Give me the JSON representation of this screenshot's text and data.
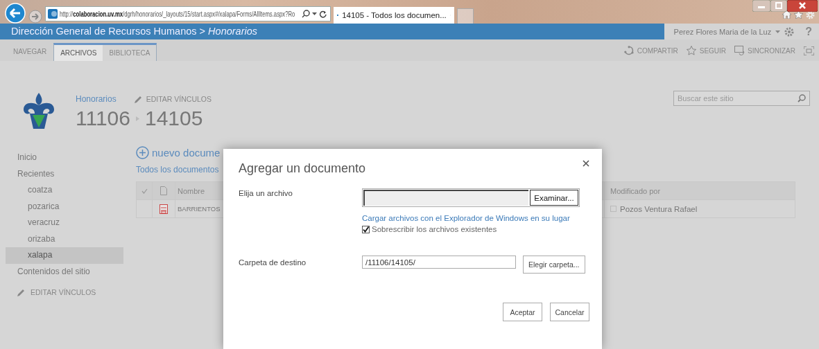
{
  "browser": {
    "address": "http://**colaboracion.uv.mx**/dgrh/honorarios/_layouts/15/start.aspx#/xalapa/Forms/AllItems.aspx?Ro",
    "tabs": [
      {
        "title": "14105 - Todos los documen...",
        "selected": true
      }
    ]
  },
  "suite_bar": {
    "title": "Dirección General de Recursos Humanos > *Honorarios*",
    "user": "Perez Flores Maria de la Luz",
    "help": "?"
  },
  "ribbon": {
    "tabs": [
      {
        "label": "NAVEGAR",
        "selected": false,
        "contextual": false
      },
      {
        "label": "ARCHIVOS",
        "selected": true,
        "contextual": true
      },
      {
        "label": "BIBLIOTECA",
        "selected": false,
        "contextual": true
      }
    ],
    "actions": [
      {
        "label": "COMPARTIR",
        "kind": "share"
      },
      {
        "label": "SEGUIR",
        "kind": "follow"
      },
      {
        "label": "SINCRONIZAR",
        "kind": "sync"
      }
    ]
  },
  "header": {
    "site_link": "Honorarios",
    "edit_links": "EDITAR VÍNCULOS",
    "breadcrumb": [
      "11106",
      "14105"
    ],
    "search": {
      "placeholder": "Buscar este sitio"
    }
  },
  "nav": {
    "items": [
      {
        "label": "Inicio",
        "selected": false
      },
      {
        "label": "Recientes",
        "selected": false,
        "children": [
          {
            "label": "coatza",
            "selected": false
          },
          {
            "label": "pozarica",
            "selected": false
          },
          {
            "label": "veracruz",
            "selected": false
          },
          {
            "label": "orizaba",
            "selected": false
          },
          {
            "label": "xalapa",
            "selected": true
          }
        ]
      },
      {
        "label": "Contenidos del sitio",
        "selected": false
      }
    ],
    "edit_links": "EDITAR VÍNCULOS"
  },
  "library": {
    "new_document": "nuevo docume",
    "view": "Todos los documentos",
    "table": {
      "columns": [
        "Nombre",
        "Modificado por"
      ],
      "rows": [
        {
          "name": "BARRIENTOS",
          "modified_by": "Pozos Ventura Rafael"
        }
      ]
    }
  },
  "dialog": {
    "title": "Agregar un documento",
    "file_label": "Elija un archivo",
    "browse": "Examinar...",
    "explorer_link": "Cargar archivos con el Explorador de Windows en su lugar",
    "overwrite": {
      "label": "Sobrescribir los archivos existentes",
      "checked": true
    },
    "folder_label": "Carpeta de destino",
    "folder": "/11106/14105/",
    "choose_folder": "Elegir carpeta...",
    "buttons": [
      "Aceptar",
      "Cancelar"
    ]
  }
}
